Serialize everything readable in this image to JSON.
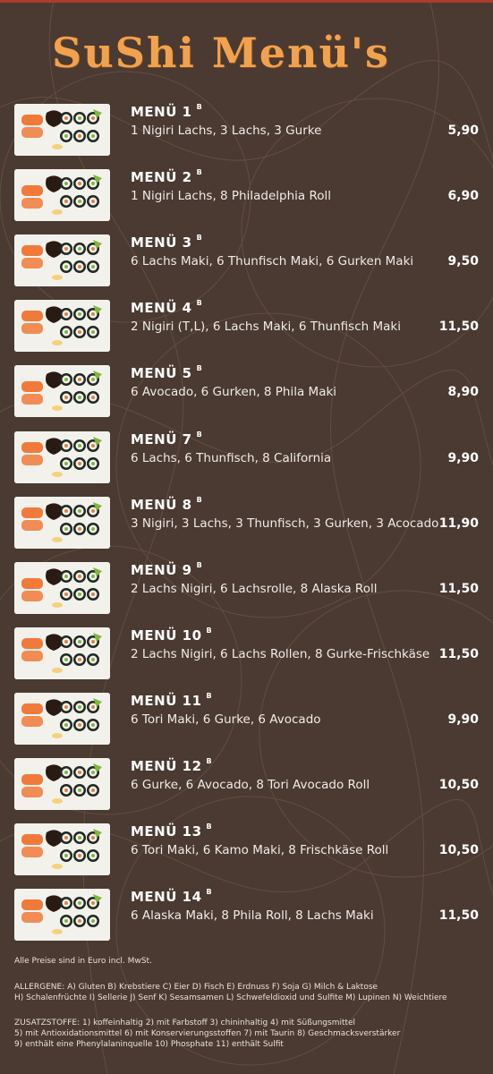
{
  "title": "SuShi Menü's",
  "allergen_marker": "B",
  "menus": [
    {
      "name": "MENÜ 1",
      "marker": "B",
      "description": "1 Nigiri Lachs, 3 Lachs, 3 Gurke",
      "price": "5,90"
    },
    {
      "name": "MENÜ 2",
      "marker": "B",
      "description": "1 Nigiri Lachs, 8 Philadelphia Roll",
      "price": "6,90"
    },
    {
      "name": "MENÜ 3",
      "marker": "B",
      "description": "6 Lachs Maki, 6 Thunfisch Maki, 6 Gurken Maki",
      "price": "9,50"
    },
    {
      "name": "MENÜ 4",
      "marker": "B",
      "description": "2 Nigiri (T,L), 6 Lachs Maki, 6 Thunfisch Maki",
      "price": "11,50"
    },
    {
      "name": "MENÜ 5",
      "marker": "B",
      "description": "6 Avocado, 6 Gurken, 8 Phila Maki",
      "price": "8,90"
    },
    {
      "name": "MENÜ 7",
      "marker": "B",
      "description": "6 Lachs, 6 Thunfisch, 8 California",
      "price": "9,90"
    },
    {
      "name": "MENÜ 8",
      "marker": "B",
      "description": "3 Nigiri, 3 Lachs, 3 Thunfisch, 3 Gurken, 3 Acocado",
      "price": "11,90"
    },
    {
      "name": "MENÜ 9",
      "marker": "B",
      "description": "2 Lachs Nigiri, 6 Lachsrolle, 8 Alaska Roll",
      "price": "11,50"
    },
    {
      "name": "MENÜ 10",
      "marker": "B",
      "description": "2 Lachs Nigiri, 6 Lachs Rollen, 8 Gurke-Frischkäse",
      "price": "11,50"
    },
    {
      "name": "MENÜ 11",
      "marker": "B",
      "description": "6 Tori Maki, 6 Gurke, 6 Avocado",
      "price": "9,90"
    },
    {
      "name": "MENÜ 12",
      "marker": "B",
      "description": "6 Gurke, 6 Avocado, 8 Tori Avocado Roll",
      "price": "10,50"
    },
    {
      "name": "MENÜ 13",
      "marker": "B",
      "description": "6 Tori Maki, 6 Kamo Maki, 8 Frischkäse Roll",
      "price": "10,50"
    },
    {
      "name": "MENÜ 14",
      "marker": "B",
      "description": "6 Alaska Maki, 8 Phila Roll, 8 Lachs Maki",
      "price": "11,50"
    }
  ],
  "footer": {
    "prices_note": "Alle Preise sind in Euro incl. MwSt.",
    "allergens_line1": "ALLERGENE: A) Gluten B) Krebstiere C) Eier D) Fisch E) Erdnuss F) Soja G) Milch & Laktose",
    "allergens_line2": "H) Schalenfrüchte I) Sellerie J) Senf K) Sesamsamen L) Schwefeldioxid und Sulfite M) Lupinen N) Weichtiere",
    "additives_line1": "ZUSATZSTOFFE: 1) koffeinhaltig 2) mit Farbstoff 3) chininhaltig 4) mit Süßungsmittel",
    "additives_line2": "5) mit Antioxidationsmittel 6) mit Konservierungsstoffen 7) mit Taurin 8) Geschmacksverstärker",
    "additives_line3": "9) enthält eine Phenylalaninquelle 10) Phosphate 11) enthält Sulfit"
  },
  "colors": {
    "background": "#4a3a32",
    "title": "#f2a24e",
    "accent_rule": "#b03a2e",
    "salmon": "#f07a3a",
    "nori": "#1f2a22",
    "avocado": "#7fb83a"
  }
}
